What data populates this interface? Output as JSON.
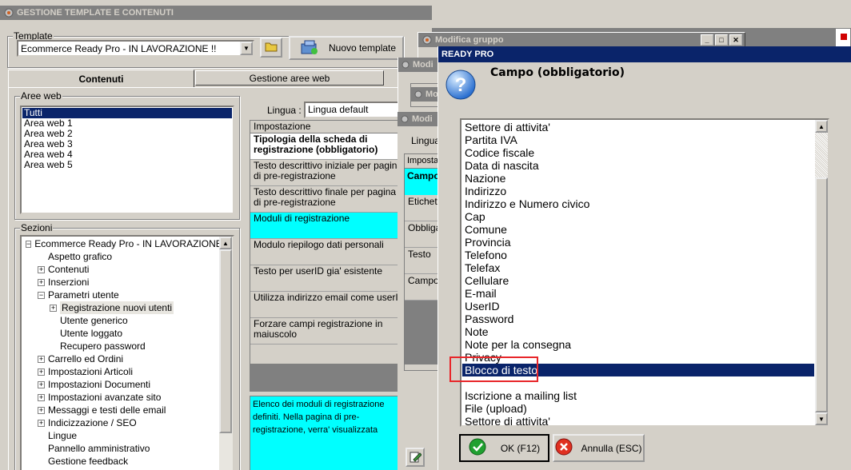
{
  "main_window": {
    "title": "GESTIONE TEMPLATE E CONTENUTI",
    "template_label": "Template",
    "template_value": "Ecommerce Ready Pro - IN LAVORAZIONE !!",
    "new_template_button": "Nuovo template",
    "tabs": [
      {
        "label": "Contenuti"
      },
      {
        "label": "Gestione aree web"
      }
    ],
    "aree_web_label": "Aree web",
    "aree_web": [
      "Tutti",
      "Area web 1",
      "Area web 2",
      "Area web 3",
      "Area web 4",
      "Area web 5"
    ],
    "sezioni_label": "Sezioni",
    "tree": [
      {
        "label": "Ecommerce Ready Pro - IN LAVORAZIONE !!",
        "expander": "−"
      },
      {
        "label": "Aspetto grafico",
        "expander": ""
      },
      {
        "label": "Contenuti",
        "expander": "+"
      },
      {
        "label": "Inserzioni",
        "expander": "+"
      },
      {
        "label": "Parametri utente",
        "expander": "−"
      },
      {
        "label": "Registrazione nuovi utenti",
        "expander": "+"
      },
      {
        "label": "Utente generico",
        "expander": ""
      },
      {
        "label": "Utente loggato",
        "expander": ""
      },
      {
        "label": "Recupero password",
        "expander": ""
      },
      {
        "label": "Carrello ed Ordini",
        "expander": "+"
      },
      {
        "label": "Impostazioni Articoli",
        "expander": "+"
      },
      {
        "label": "Impostazioni Documenti",
        "expander": "+"
      },
      {
        "label": "Impostazioni avanzate sito",
        "expander": "+"
      },
      {
        "label": "Messaggi e testi delle email",
        "expander": "+"
      },
      {
        "label": "Indicizzazione / SEO",
        "expander": "+"
      },
      {
        "label": "Lingue",
        "expander": ""
      },
      {
        "label": "Pannello amministrativo",
        "expander": ""
      },
      {
        "label": "Gestione feedback",
        "expander": ""
      }
    ],
    "lingua_label": "Lingua :",
    "lingua_value": "Lingua default",
    "settings_header": "Impostazione",
    "settings": [
      "Tipologia della scheda di registrazione (obbligatorio)",
      "Testo descrittivo iniziale per pagina di pre-registrazione",
      "Testo descrittivo finale per pagina di pre-registrazione",
      "Moduli di registrazione",
      "Modulo riepilogo dati personali",
      "Testo per userID gia' esistente",
      "Utilizza indirizzo email come userID",
      "Forzare campi registrazione in maiuscolo"
    ],
    "description": "Elenco dei moduli di registrazione definiti. Nella pagina di pre-registrazione, verra' visualizzata"
  },
  "modifica_gruppo": {
    "title": "Modifica gruppo"
  },
  "back_windows": {
    "title_1": "Modi",
    "title_2": "Mo",
    "title_3": "Modi",
    "lingua": "Lingua",
    "header": "Imposta",
    "rows": [
      "Campo",
      "Etichett",
      "Obbliga",
      "Testo",
      "Campo"
    ]
  },
  "dialog": {
    "title": "READY PRO",
    "prompt": "Campo (obbligatorio)",
    "items": [
      "Settore di attivita'",
      "Partita IVA",
      "Codice fiscale",
      "Data di nascita",
      "Nazione",
      "Indirizzo",
      "Indirizzo e Numero civico",
      "Cap",
      "Comune",
      "Provincia",
      "Telefono",
      "Telefax",
      "Cellulare",
      "E-mail",
      "UserID",
      "Password",
      "Note",
      "Note per la consegna",
      "Privacy",
      "Blocco di testo",
      "",
      "Iscrizione a mailing list",
      "File (upload)",
      "Settore di attivita'"
    ],
    "selected_index": 19,
    "ok_button": "OK (F12)",
    "cancel_button": "Annulla (ESC)"
  },
  "colors": {
    "highlight": "#0a246a",
    "cyan": "#00ffff",
    "annotation_red": "#e8262a"
  }
}
